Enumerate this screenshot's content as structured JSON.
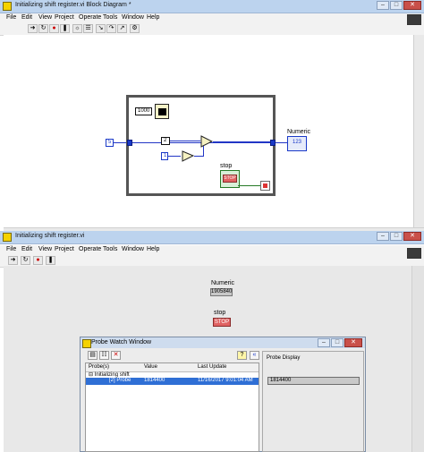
{
  "block_diagram": {
    "title": "Initializing shift register.vi Block Diagram *",
    "menu": [
      "File",
      "Edit",
      "View",
      "Project",
      "Operate",
      "Tools",
      "Window",
      "Help"
    ],
    "toolbar_icons": [
      "run-arrow-icon",
      "run-continuous-icon",
      "abort-icon",
      "pause-icon",
      "highlight-execution-icon",
      "retain-wire-values-icon",
      "step-into-icon",
      "step-over-icon",
      "step-out-icon",
      "probe-icon"
    ],
    "nodes": {
      "wait_ms_const": "1000",
      "init_const": "5",
      "const_two": "2",
      "const_one": "1",
      "indicator_label": "Numeric",
      "indicator_value": "123",
      "stop_label": "stop",
      "stop_value": "STOP"
    }
  },
  "front_panel": {
    "title": "Initializing shift register.vi",
    "menu": [
      "File",
      "Edit",
      "View",
      "Project",
      "Operate",
      "Tools",
      "Window",
      "Help"
    ],
    "numeric_label": "Numeric",
    "numeric_value": "1905840",
    "stop_label": "stop",
    "stop_button": "STOP"
  },
  "probe_window": {
    "title": "Probe Watch Window",
    "columns": [
      "Probe(s)",
      "Value",
      "Last Update"
    ],
    "group": "Initializing shift",
    "row": {
      "probe": "[2] Probe",
      "value": "1814400",
      "last_update": "11/16/2017 9:01:04 AM"
    },
    "display_label": "Probe Display",
    "display_value": "1814400"
  }
}
